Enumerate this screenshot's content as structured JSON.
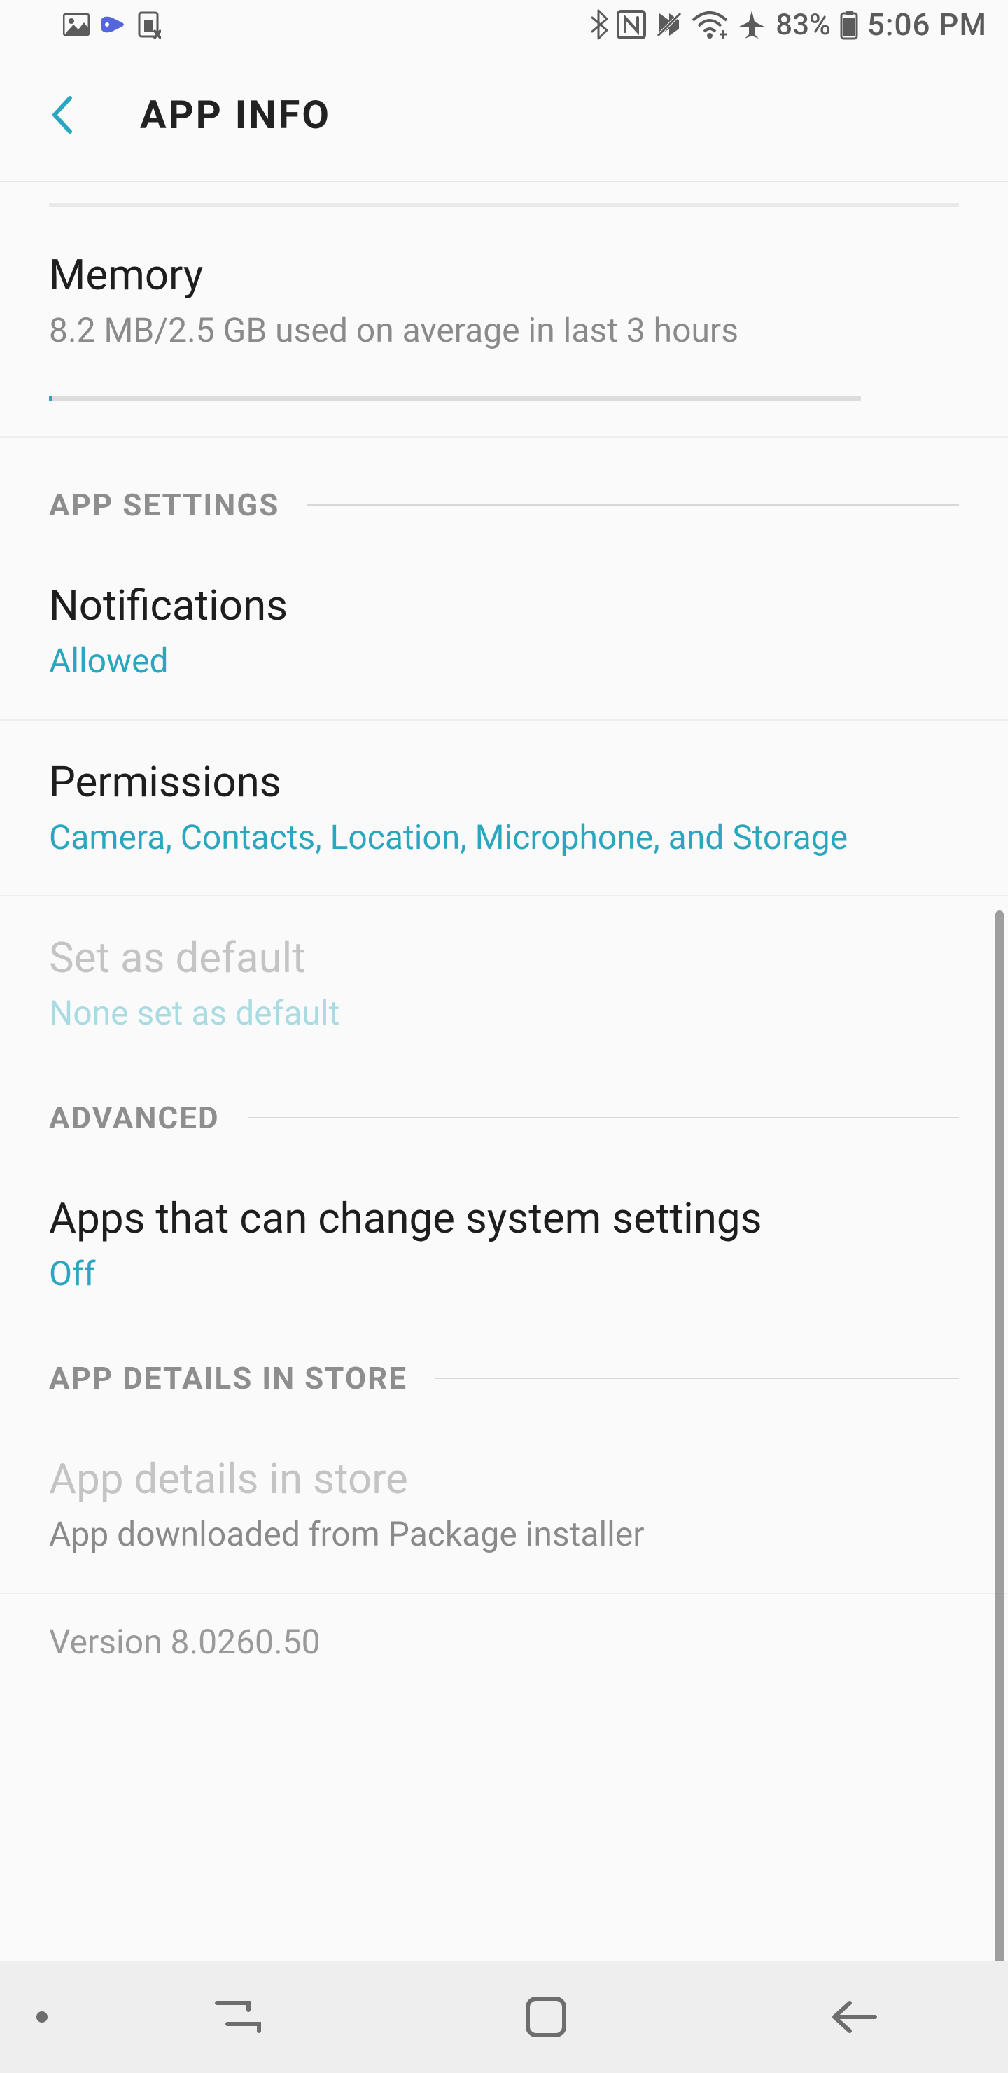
{
  "status": {
    "battery_pct": "83%",
    "time": "5:06 PM"
  },
  "header": {
    "title": "APP INFO"
  },
  "memory": {
    "title": "Memory",
    "subtitle": "8.2 MB/2.5 GB used on average in last 3 hours"
  },
  "sections": {
    "app_settings": "APP SETTINGS",
    "advanced": "ADVANCED",
    "app_details_store": "APP DETAILS IN STORE"
  },
  "items": {
    "notifications": {
      "title": "Notifications",
      "value": "Allowed"
    },
    "permissions": {
      "title": "Permissions",
      "value": "Camera, Contacts, Location, Microphone, and Storage"
    },
    "set_default": {
      "title": "Set as default",
      "value": "None set as default"
    },
    "sys_settings": {
      "title": "Apps that can change system settings",
      "value": "Off"
    },
    "store_details": {
      "title": "App details in store",
      "value": "App downloaded from Package installer"
    }
  },
  "version": "Version 8.0260.50"
}
